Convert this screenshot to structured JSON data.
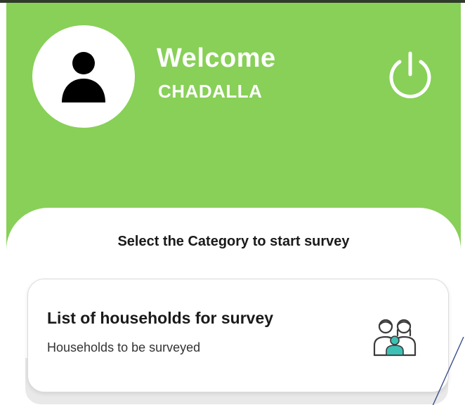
{
  "header": {
    "welcome": "Welcome",
    "username": "CHADALLA",
    "background_color": "#88d058",
    "avatar_icon": "person-icon",
    "power_icon": "power-icon"
  },
  "main": {
    "section_title": "Select the Category to start survey",
    "card": {
      "title": "List of households for survey",
      "subtitle": "Households to be surveyed",
      "icon": "household-members-icon",
      "accent_color": "#3ec1b4"
    }
  }
}
